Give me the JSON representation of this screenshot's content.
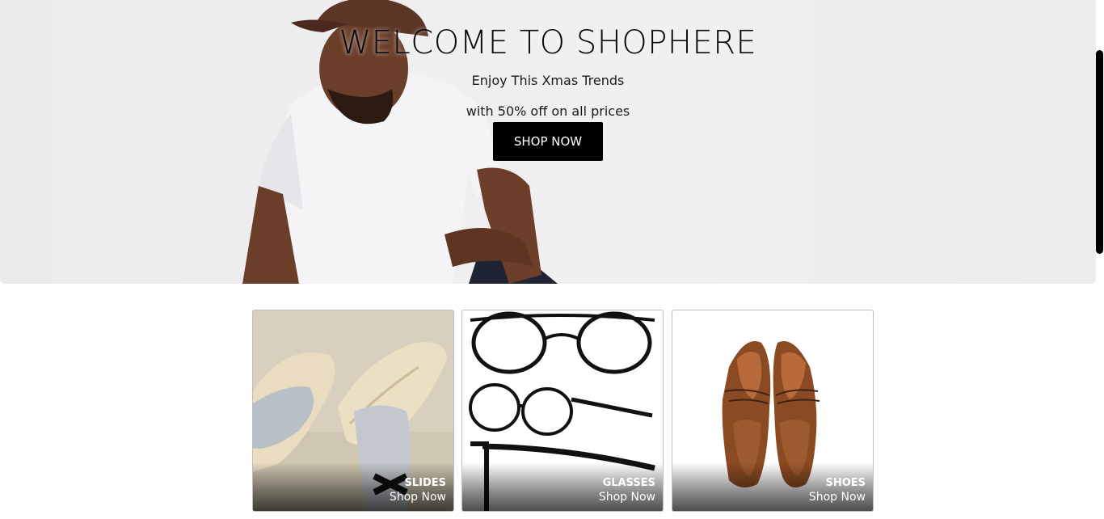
{
  "hero": {
    "title": "WELCOME TO SHOPHERE",
    "subtitle_line1": "Enjoy This Xmas Trends",
    "subtitle_line2": "with 50% off on all prices",
    "cta_label": "SHOP NOW",
    "background_color": "#eeeeee",
    "cta_color": "#000000"
  },
  "categories": [
    {
      "name": "SLIDES",
      "link_label": "Shop Now",
      "image": "slides-photo"
    },
    {
      "name": "GLASSES",
      "link_label": "Shop Now",
      "image": "glasses-photo"
    },
    {
      "name": "SHOES",
      "link_label": "Shop Now",
      "image": "shoes-photo"
    }
  ],
  "scrollbar": {
    "color": "#000000"
  }
}
